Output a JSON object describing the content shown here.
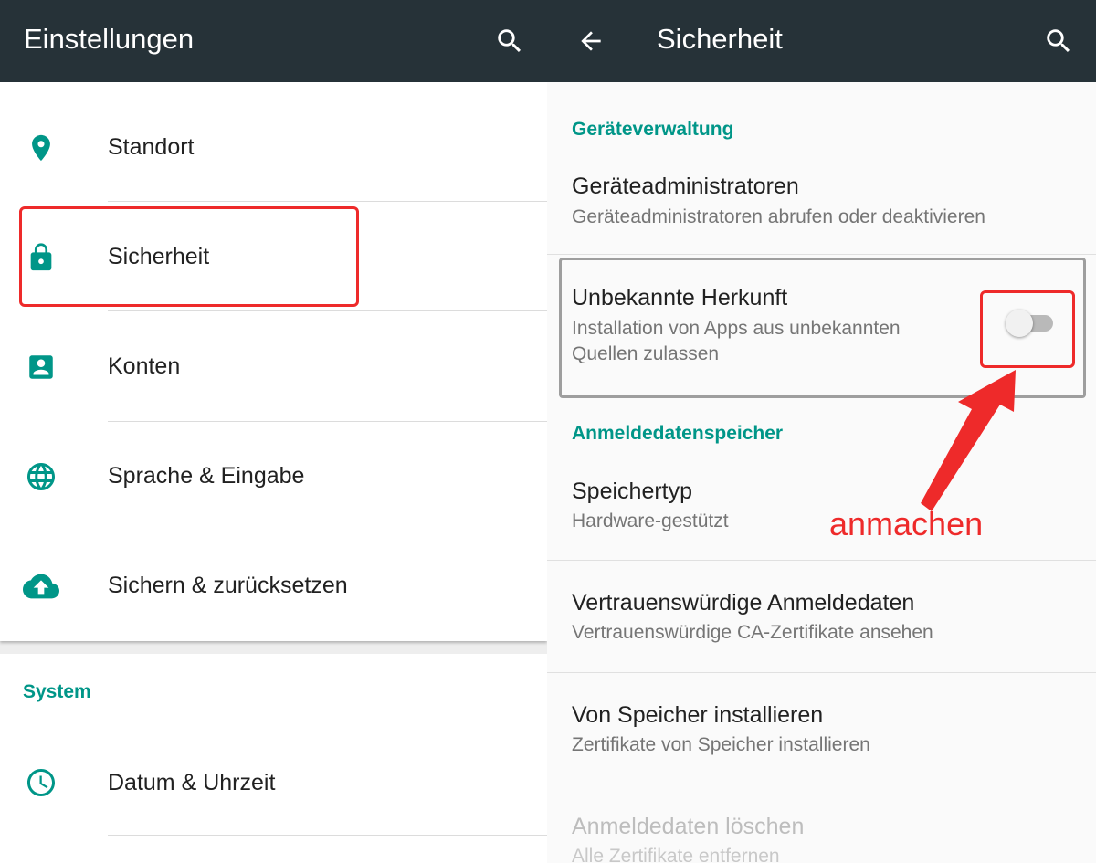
{
  "left": {
    "appbar": {
      "title": "Einstellungen",
      "search_icon": "search-icon"
    },
    "items": [
      {
        "label": "Standort",
        "icon": "location-pin-icon"
      },
      {
        "label": "Sicherheit",
        "icon": "lock-icon"
      },
      {
        "label": "Konten",
        "icon": "account-box-icon"
      },
      {
        "label": "Sprache & Eingabe",
        "icon": "globe-icon"
      },
      {
        "label": "Sichern & zurücksetzen",
        "icon": "cloud-upload-icon"
      }
    ],
    "system": {
      "header": "System",
      "items": [
        {
          "label": "Datum & Uhrzeit",
          "icon": "clock-icon"
        }
      ]
    }
  },
  "right": {
    "appbar": {
      "title": "Sicherheit",
      "back_icon": "arrow-back-icon",
      "search_icon": "search-icon"
    },
    "sections": [
      {
        "header": "Geräteverwaltung",
        "prefs": [
          {
            "title": "Geräteadministratoren",
            "summary": "Geräteadministratoren abrufen oder deaktivieren"
          },
          {
            "title": "Unbekannte Herkunft",
            "summary_line1": "Installation von Apps aus unbekannten",
            "summary_line2": "Quellen zulassen",
            "toggle_state": "off"
          }
        ]
      },
      {
        "header": "Anmeldedatenspeicher",
        "prefs": [
          {
            "title": "Speichertyp",
            "summary": "Hardware-gestützt"
          },
          {
            "title": "Vertrauenswürdige Anmeldedaten",
            "summary": "Vertrauenswürdige CA-Zertifikate ansehen"
          },
          {
            "title": "Von Speicher installieren",
            "summary": "Zertifikate von Speicher installieren"
          },
          {
            "title": "Anmeldedaten löschen",
            "summary": "Alle Zertifikate entfernen",
            "state": "disabled"
          }
        ]
      }
    ]
  },
  "annotation": {
    "text": "anmachen",
    "color": "#ee2a2a"
  },
  "colors": {
    "appbar": "#263238",
    "accent": "#009688",
    "highlight": "#ee2a2a"
  }
}
